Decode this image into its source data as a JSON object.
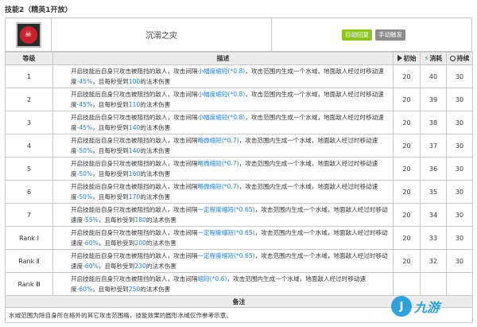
{
  "title": "技能2（精英1开放）",
  "skill": {
    "name": "沉溺之灾",
    "tags": [
      "自动回复",
      "手动触发"
    ],
    "icon": "skill-icon"
  },
  "columns": {
    "level": "等级",
    "description": "描述",
    "initial": "初始",
    "cost": "消耗",
    "duration": "持续"
  },
  "rows": [
    {
      "level": "1",
      "pre": "开启技能后自身只攻击被阻挡的敌人，攻击间隔",
      "interval": "小幅度缩短(*0.8)",
      "mid": "，攻击范围内生成一个水域，地面敌人经过时移动速度",
      "slow": "-45%",
      "post1": "，且每秒受到",
      "dmg": "100",
      "post2": "的法术伤害",
      "initial": "20",
      "cost": "40",
      "duration": "30"
    },
    {
      "level": "2",
      "pre": "开启技能后自身只攻击被阻挡的敌人，攻击间隔",
      "interval": "小幅度缩短(*0.8)",
      "mid": "，攻击范围内生成一个水域，地面敌人经过时移动速度",
      "slow": "-45%",
      "post1": "，且每秒受到",
      "dmg": "110",
      "post2": "的法术伤害",
      "initial": "20",
      "cost": "39",
      "duration": "30"
    },
    {
      "level": "3",
      "pre": "开启技能后自身只攻击被阻挡的敌人，攻击间隔",
      "interval": "小幅度缩短(*0.8)",
      "mid": "，攻击范围内生成一个水域，地面敌人经过时移动速度",
      "slow": "-45%",
      "post1": "，且每秒受到",
      "dmg": "140",
      "post2": "的法术伤害",
      "initial": "20",
      "cost": "38",
      "duration": "30"
    },
    {
      "level": "4",
      "pre": "开启技能后自身只攻击被阻挡的敌人，攻击间隔",
      "interval": "略微缩短(*0.7)",
      "mid": "，攻击范围内生成一个水域，地面敌人经过时移动速度",
      "slow": "-50%",
      "post1": "，且每秒受到",
      "dmg": "140",
      "post2": "的法术伤害",
      "initial": "20",
      "cost": "37",
      "duration": "30"
    },
    {
      "level": "5",
      "pre": "开启技能后自身只攻击被阻挡的敌人，攻击间隔",
      "interval": "略微缩短(*0.7)",
      "mid": "，攻击范围内生成一个水域，地面敌人经过时移动速度",
      "slow": "-50%",
      "post1": "，且每秒受到",
      "dmg": "160",
      "post2": "的法术伤害",
      "initial": "20",
      "cost": "36",
      "duration": "30"
    },
    {
      "level": "6",
      "pre": "开启技能后自身只攻击被阻挡的敌人，攻击间隔",
      "interval": "略微缩短(*0.7)",
      "mid": "，攻击范围内生成一个水域，地面敌人经过时移动速度",
      "slow": "-50%",
      "post1": "，且每秒受到",
      "dmg": "170",
      "post2": "的法术伤害",
      "initial": "20",
      "cost": "35",
      "duration": "30"
    },
    {
      "level": "7",
      "pre": "开启技能后自身只攻击被阻挡的敌人，攻击间隔",
      "interval": "一定程度缩短(*0.65)",
      "mid": "，攻击范围内生成一个水域，地面敌人经过时移动速度",
      "slow": "-55%",
      "post1": "，且每秒受到",
      "dmg": "180",
      "post2": "的法术伤害",
      "initial": "20",
      "cost": "34",
      "duration": "30"
    },
    {
      "level": "Rank Ⅰ",
      "pre": "开启技能后自身只攻击被阻挡的敌人，攻击间隔",
      "interval": "一定程度缩短(*0.65)",
      "mid": "，攻击范围内生成一个水域，地面敌人经过时移动速度",
      "slow": "-60%",
      "post1": "，且每秒受到",
      "dmg": "200",
      "post2": "的法术伤害",
      "initial": "20",
      "cost": "33",
      "duration": "30"
    },
    {
      "level": "Rank Ⅱ",
      "pre": "开启技能后自身只攻击被阻挡的敌人，攻击间隔",
      "interval": "一定程度缩短(*0.65)",
      "mid": "，攻击范围内生成一个水域，地面敌人经过时移动速度",
      "slow": "-60%",
      "post1": "，且每秒受到",
      "dmg": "230",
      "post2": "的法术伤害",
      "initial": "20",
      "cost": "32",
      "duration": "30"
    },
    {
      "level": "Rank Ⅲ",
      "pre": "开启技能后自身只攻击被阻挡的敌人，攻击间隔",
      "interval": "缩短(*0.6)",
      "mid": "，攻击范围内生成一个水域，地面敌人经过时移动速度",
      "slow": "-60%",
      "post1": "，且每秒受到",
      "dmg": "250",
      "post2": "的法术伤害",
      "initial": "",
      "cost": "",
      "duration": ""
    }
  ],
  "note_header": "备注",
  "note": "水域范围为除自身所在格外的其它攻击范围格，技能效果的圆形水域仅作参考示意。",
  "watermark": "九游",
  "colors": {
    "tag_auto": "#8dc21f",
    "tag_manual": "#8c8c8c",
    "interval": "#1e7ed6",
    "slow": "#e07b1a",
    "damage": "#1e7ed6"
  }
}
